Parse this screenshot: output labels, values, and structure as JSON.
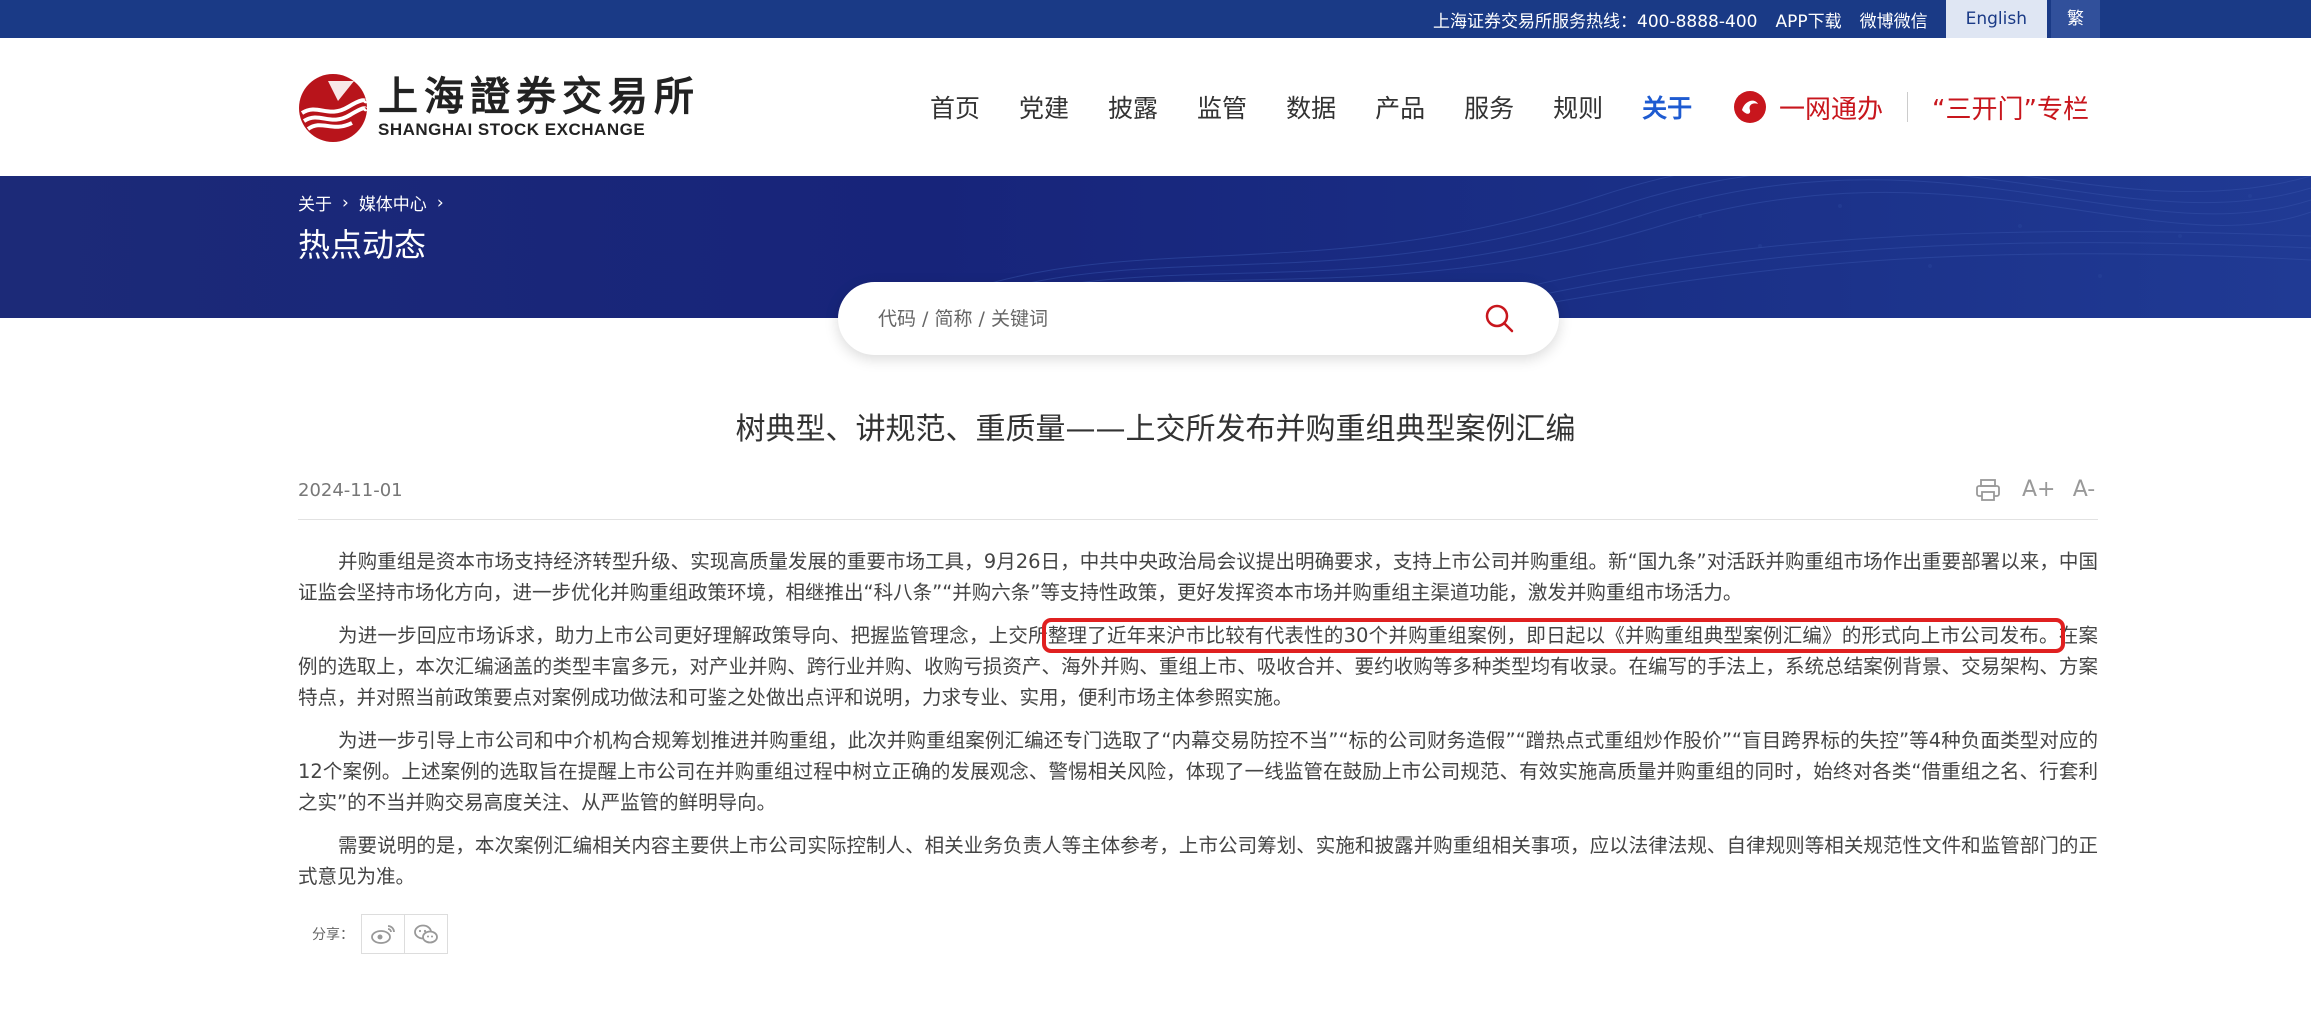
{
  "topbar": {
    "hotline": "上海证券交易所服务热线：400-8888-400",
    "app_download": "APP下载",
    "weibo_weixin": "微博微信",
    "english": "English",
    "traditional": "繁"
  },
  "logo": {
    "cn": "上海證券交易所",
    "en": "SHANGHAI STOCK EXCHANGE"
  },
  "nav": {
    "items": [
      "首页",
      "党建",
      "披露",
      "监管",
      "数据",
      "产品",
      "服务",
      "规则",
      "关于"
    ],
    "active": "关于"
  },
  "header_right": {
    "yiwang": "一网通办",
    "sankaimen": "“三开门”专栏"
  },
  "banner": {
    "breadcrumb": [
      "关于",
      "媒体中心"
    ],
    "title": "热点动态"
  },
  "search": {
    "placeholder": "代码 / 简称 / 关键词",
    "value": ""
  },
  "article": {
    "title": "树典型、讲规范、重质量——上交所发布并购重组典型案例汇编",
    "date": "2024-11-01",
    "tools": [
      "print-icon",
      "font-increase-icon",
      "font-decrease-icon"
    ],
    "tool_labels": {
      "increase": "A+",
      "decrease": "A-"
    },
    "p1": "并购重组是资本市场支持经济转型升级、实现高质量发展的重要市场工具，9月26日，中共中央政治局会议提出明确要求，支持上市公司并购重组。新“国九条”对活跃并购重组市场作出重要部署以来，中国证监会坚持市场化方向，进一步优化并购重组政策环境，相继推出“科八条”“并购六条”等支持性政策，更好发挥资本市场并购重组主渠道功能，激发并购重组市场活力。",
    "p2_before": "为进一步回应市场诉求，助力上市公司更好理解政策导向、把握监管理念，上交所",
    "p2_highlight": "整理了近年来沪市比较有代表性的30个并购重组案例，即日起以《并购重组典型案例汇编》的形式向上市公司发布。",
    "p2_after": "在案例的选取上，本次汇编涵盖的类型丰富多元，对产业并购、跨行业并购、收购亏损资产、海外并购、重组上市、吸收合并、要约收购等多种类型均有收录。在编写的手法上，系统总结案例背景、交易架构、方案特点，并对照当前政策要点对案例成功做法和可鉴之处做出点评和说明，力求专业、实用，便利市场主体参照实施。",
    "p3": "为进一步引导上市公司和中介机构合规筹划推进并购重组，此次并购重组案例汇编还专门选取了“内幕交易防控不当”“标的公司财务造假”“蹭热点式重组炒作股价”“盲目跨界标的失控”等4种负面类型对应的12个案例。上述案例的选取旨在提醒上市公司在并购重组过程中树立正确的发展观念、警惕相关风险，体现了一线监管在鼓励上市公司规范、有效实施高质量并购重组的同时，始终对各类“借重组之名、行套利之实”的不当并购交易高度关注、从严监管的鲜明导向。",
    "p4": "需要说明的是，本次案例汇编相关内容主要供上市公司实际控制人、相关业务负责人等主体参考，上市公司筹划、实施和披露并购重组相关事项，应以法律法规、自律规则等相关规范性文件和监管部门的正式意见为准。"
  },
  "share": {
    "label": "分享：",
    "targets": [
      "weibo-icon",
      "wechat-icon"
    ]
  },
  "colors": {
    "topbar": "#1a3a86",
    "brand_red": "#c8161d",
    "nav_active": "#1e5bd1",
    "highlight_box": "#e02020"
  }
}
